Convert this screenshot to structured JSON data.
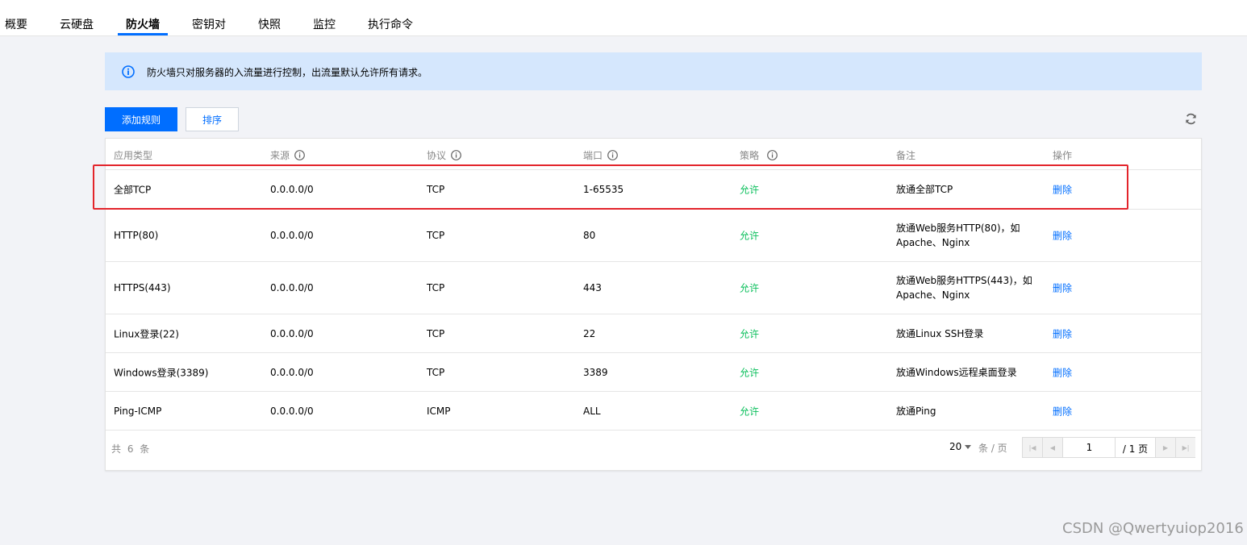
{
  "tabs": [
    {
      "label": "概要",
      "active": false
    },
    {
      "label": "云硬盘",
      "active": false
    },
    {
      "label": "防火墙",
      "active": true
    },
    {
      "label": "密钥对",
      "active": false
    },
    {
      "label": "快照",
      "active": false
    },
    {
      "label": "监控",
      "active": false
    },
    {
      "label": "执行命令",
      "active": false
    }
  ],
  "notice": {
    "text": "防火墙只对服务器的入流量进行控制，出流量默认允许所有请求。",
    "icon": "info-icon"
  },
  "toolbar": {
    "add_rule_label": "添加规则",
    "sort_label": "排序",
    "refresh_icon": "refresh-icon"
  },
  "table": {
    "columns": [
      {
        "label": "应用类型",
        "help": false
      },
      {
        "label": "来源",
        "help": true
      },
      {
        "label": "协议",
        "help": true
      },
      {
        "label": "端口",
        "help": true
      },
      {
        "label": "策略",
        "help": true
      },
      {
        "label": "备注",
        "help": false
      },
      {
        "label": "操作",
        "help": false
      }
    ],
    "rows": [
      {
        "app": "全部TCP",
        "source": "0.0.0.0/0",
        "protocol": "TCP",
        "port": "1-65535",
        "policy": "允许",
        "note": "放通全部TCP",
        "action": "删除",
        "highlighted": true
      },
      {
        "app": "HTTP(80)",
        "source": "0.0.0.0/0",
        "protocol": "TCP",
        "port": "80",
        "policy": "允许",
        "note": "放通Web服务HTTP(80)，如Apache、Nginx",
        "action": "删除"
      },
      {
        "app": "HTTPS(443)",
        "source": "0.0.0.0/0",
        "protocol": "TCP",
        "port": "443",
        "policy": "允许",
        "note": "放通Web服务HTTPS(443)，如Apache、Nginx",
        "action": "删除"
      },
      {
        "app": "Linux登录(22)",
        "source": "0.0.0.0/0",
        "protocol": "TCP",
        "port": "22",
        "policy": "允许",
        "note": "放通Linux SSH登录",
        "action": "删除"
      },
      {
        "app": "Windows登录(3389)",
        "source": "0.0.0.0/0",
        "protocol": "TCP",
        "port": "3389",
        "policy": "允许",
        "note": "放通Windows远程桌面登录",
        "action": "删除"
      },
      {
        "app": "Ping-ICMP",
        "source": "0.0.0.0/0",
        "protocol": "ICMP",
        "port": "ALL",
        "policy": "允许",
        "note": "放通Ping",
        "action": "删除"
      }
    ]
  },
  "pagination": {
    "total_text": "共 6 条",
    "page_size": "20",
    "page_size_unit": "条 / 页",
    "current_page": "1",
    "total_pages_text": "/ 1 页"
  },
  "watermark": "CSDN @Qwertyuiop2016",
  "colors": {
    "primary": "#006eff",
    "allow": "#0abf5b",
    "notice_bg": "#d5e7fd",
    "highlight": "#e3242b"
  }
}
